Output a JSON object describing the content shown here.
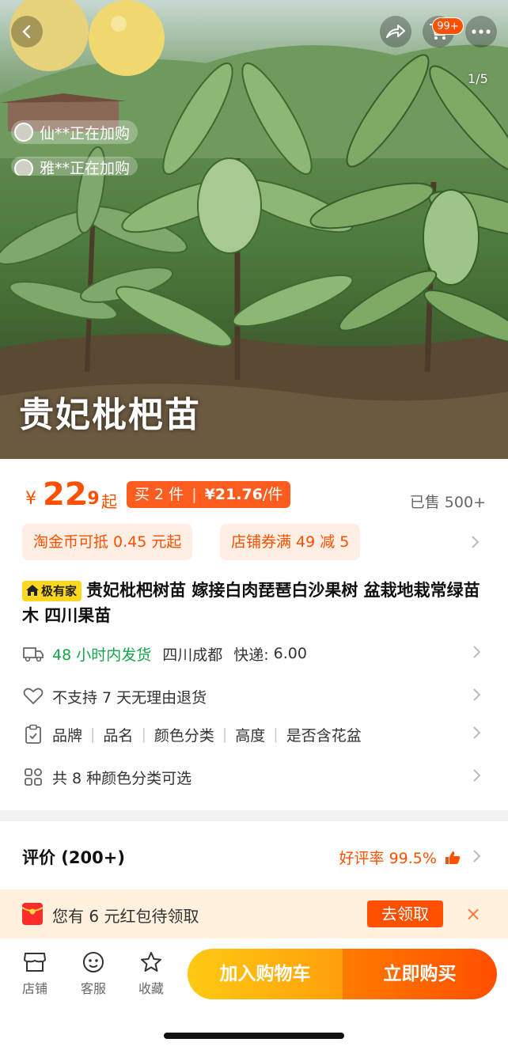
{
  "hero": {
    "caption": "贵妃枇杷苗",
    "page_indicator": "1/5",
    "cart_badge": "99+",
    "buyers": [
      "仙**正在加购",
      "雅**正在加购"
    ]
  },
  "price": {
    "currency": "¥",
    "integer": "22",
    "decimal": ".9",
    "suffix": "起",
    "multi_buy_qty": "买 2 件",
    "multi_buy_price": "¥21.76",
    "multi_buy_unit": "/件",
    "sold": "已售 500+"
  },
  "promos": [
    "淘金币可抵 0.45 元起",
    "店铺券满 49 减 5"
  ],
  "product": {
    "brand_badge": "极有家",
    "title": "贵妃枇杷树苗 嫁接白肉琵琶白沙果树 盆栽地栽常绿苗木 四川果苗"
  },
  "shipping": {
    "delivery": "48 小时内发货",
    "origin": "四川成都",
    "fee_label": "快递:",
    "fee": "6.00"
  },
  "returns": "不支持 7 天无理由退货",
  "params": [
    "品牌",
    "品名",
    "颜色分类",
    "高度",
    "是否含花盆"
  ],
  "variants": "共 8 种颜色分类可选",
  "reviews": {
    "title": "评价 (200+)",
    "rate": "好评率 99.5%"
  },
  "coupon": {
    "text": "您有 6 元红包待领取",
    "button": "去领取",
    "close": "×"
  },
  "bottom": {
    "shop": "店铺",
    "service": "客服",
    "favorite": "收藏",
    "add_to_cart": "加入购物车",
    "buy_now": "立即购买"
  },
  "colors": {
    "accent": "#ff5000",
    "green": "#17a34a",
    "cart_btn": "#ffb80e",
    "buy_btn": "#ff5a00"
  }
}
